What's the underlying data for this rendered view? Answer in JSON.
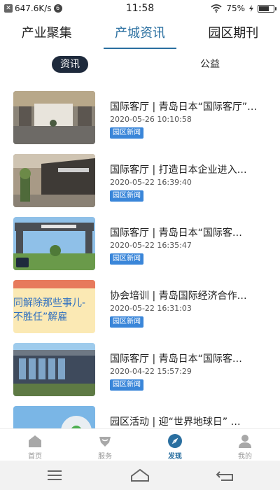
{
  "status_bar": {
    "network_speed": "647.6K/s",
    "sim_badge": "6",
    "time": "11:58",
    "battery": "75%",
    "battery_level": 0.75
  },
  "top_tabs": [
    {
      "label": "产业聚集",
      "active": false
    },
    {
      "label": "产城资讯",
      "active": true
    },
    {
      "label": "园区期刊",
      "active": false
    }
  ],
  "sub_tabs": [
    {
      "label": "资讯",
      "active": true
    },
    {
      "label": "公益",
      "active": false
    }
  ],
  "news": [
    {
      "title": "国际客厅 | 青岛日本“国际客厅”…",
      "date": "2020-05-26 10:10:58",
      "tag": "园区新闻",
      "thumb_name": "lobby-interior-photo"
    },
    {
      "title": "国际客厅 | 打造日本企业进入…",
      "date": "2020-05-22 16:39:40",
      "tag": "园区新闻",
      "thumb_name": "reception-wall-photo"
    },
    {
      "title": "国际客厅 | 青岛日本“国际客…",
      "date": "2020-05-22 16:35:47",
      "tag": "园区新闻",
      "thumb_name": "entrance-gate-photo"
    },
    {
      "title": "协会培训 | 青岛国际经济合作…",
      "date": "2020-05-22 16:31:03",
      "tag": "园区新闻",
      "thumb_name": "training-banner-graphic",
      "thumb_text_1": "同解除那些事儿-",
      "thumb_text_2": "不胜任”解雇"
    },
    {
      "title": "国际客厅 | 青岛日本“国际客…",
      "date": "2020-04-22 15:57:29",
      "tag": "园区新闻",
      "thumb_name": "building-exterior-photo"
    },
    {
      "title": "园区活动 | 迎“世界地球日” …",
      "date": "",
      "tag": "",
      "thumb_name": "earth-day-graphic"
    }
  ],
  "bottom_nav": [
    {
      "label": "首页",
      "icon": "home-icon",
      "active": false
    },
    {
      "label": "服务",
      "icon": "service-icon",
      "active": false
    },
    {
      "label": "发现",
      "icon": "discover-icon",
      "active": true
    },
    {
      "label": "我的",
      "icon": "profile-icon",
      "active": false
    }
  ],
  "colors": {
    "accent": "#2a6fa0",
    "tag_bg": "#3a86d9",
    "sub_tab_active_bg": "#1e2a3c",
    "nav_inactive": "#999999"
  }
}
